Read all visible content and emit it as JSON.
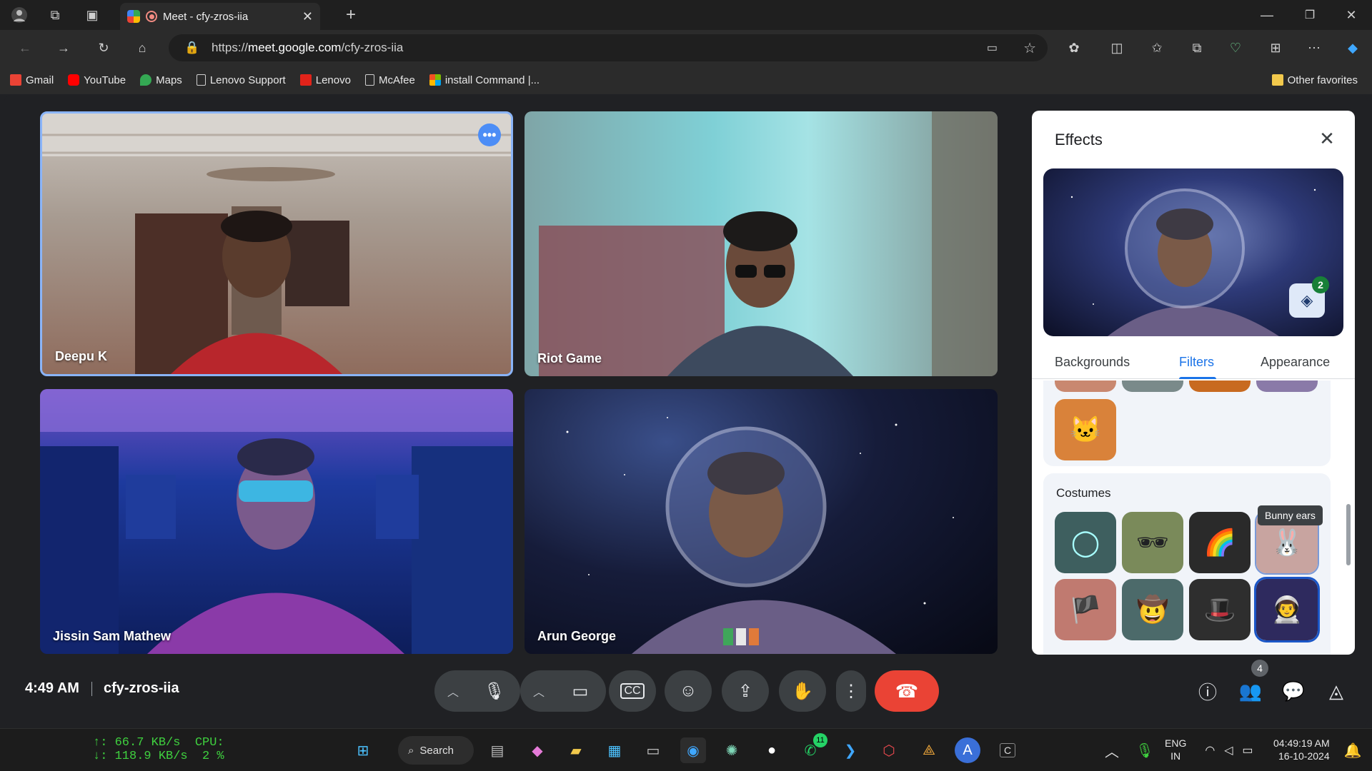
{
  "browser": {
    "tab_title": "Meet - cfy-zros-iia",
    "url_prefix": "https://",
    "url_host": "meet.google.com",
    "url_path": "/cfy-zros-iia",
    "favorites": [
      {
        "label": "Gmail",
        "color": "#ea4335"
      },
      {
        "label": "YouTube",
        "color": "#ff0000"
      },
      {
        "label": "Maps",
        "color": "#34a853"
      },
      {
        "label": "Lenovo Support",
        "color": "#cfcfcf"
      },
      {
        "label": "Lenovo",
        "color": "#e2231a"
      },
      {
        "label": "McAfee",
        "color": "#cfcfcf"
      },
      {
        "label": "install Command |...",
        "color": "#4285f4"
      }
    ],
    "other_favorites": "Other favorites"
  },
  "participants": [
    {
      "name": "Deepu K"
    },
    {
      "name": "Riot Game"
    },
    {
      "name": "Jissin Sam Mathew"
    },
    {
      "name": "Arun George"
    }
  ],
  "effects": {
    "title": "Effects",
    "layer_count": "2",
    "tabs": [
      "Backgrounds",
      "Filters",
      "Appearance"
    ],
    "active_tab": "Filters",
    "costumes_title": "Costumes",
    "tooltip": "Bunny ears"
  },
  "meeting": {
    "time": "4:49 AM",
    "code": "cfy-zros-iia",
    "people_count": "4"
  },
  "taskbar": {
    "net_up": "↑: 66.7 KB/s",
    "net_down": "↓: 118.9 KB/s",
    "cpu_label": "CPU:",
    "cpu_value": "2 %",
    "search_label": "Search",
    "whatsapp_badge": "11",
    "lang_1": "ENG",
    "lang_2": "IN",
    "time": "04:49:19 AM",
    "date": "16-10-2024"
  }
}
